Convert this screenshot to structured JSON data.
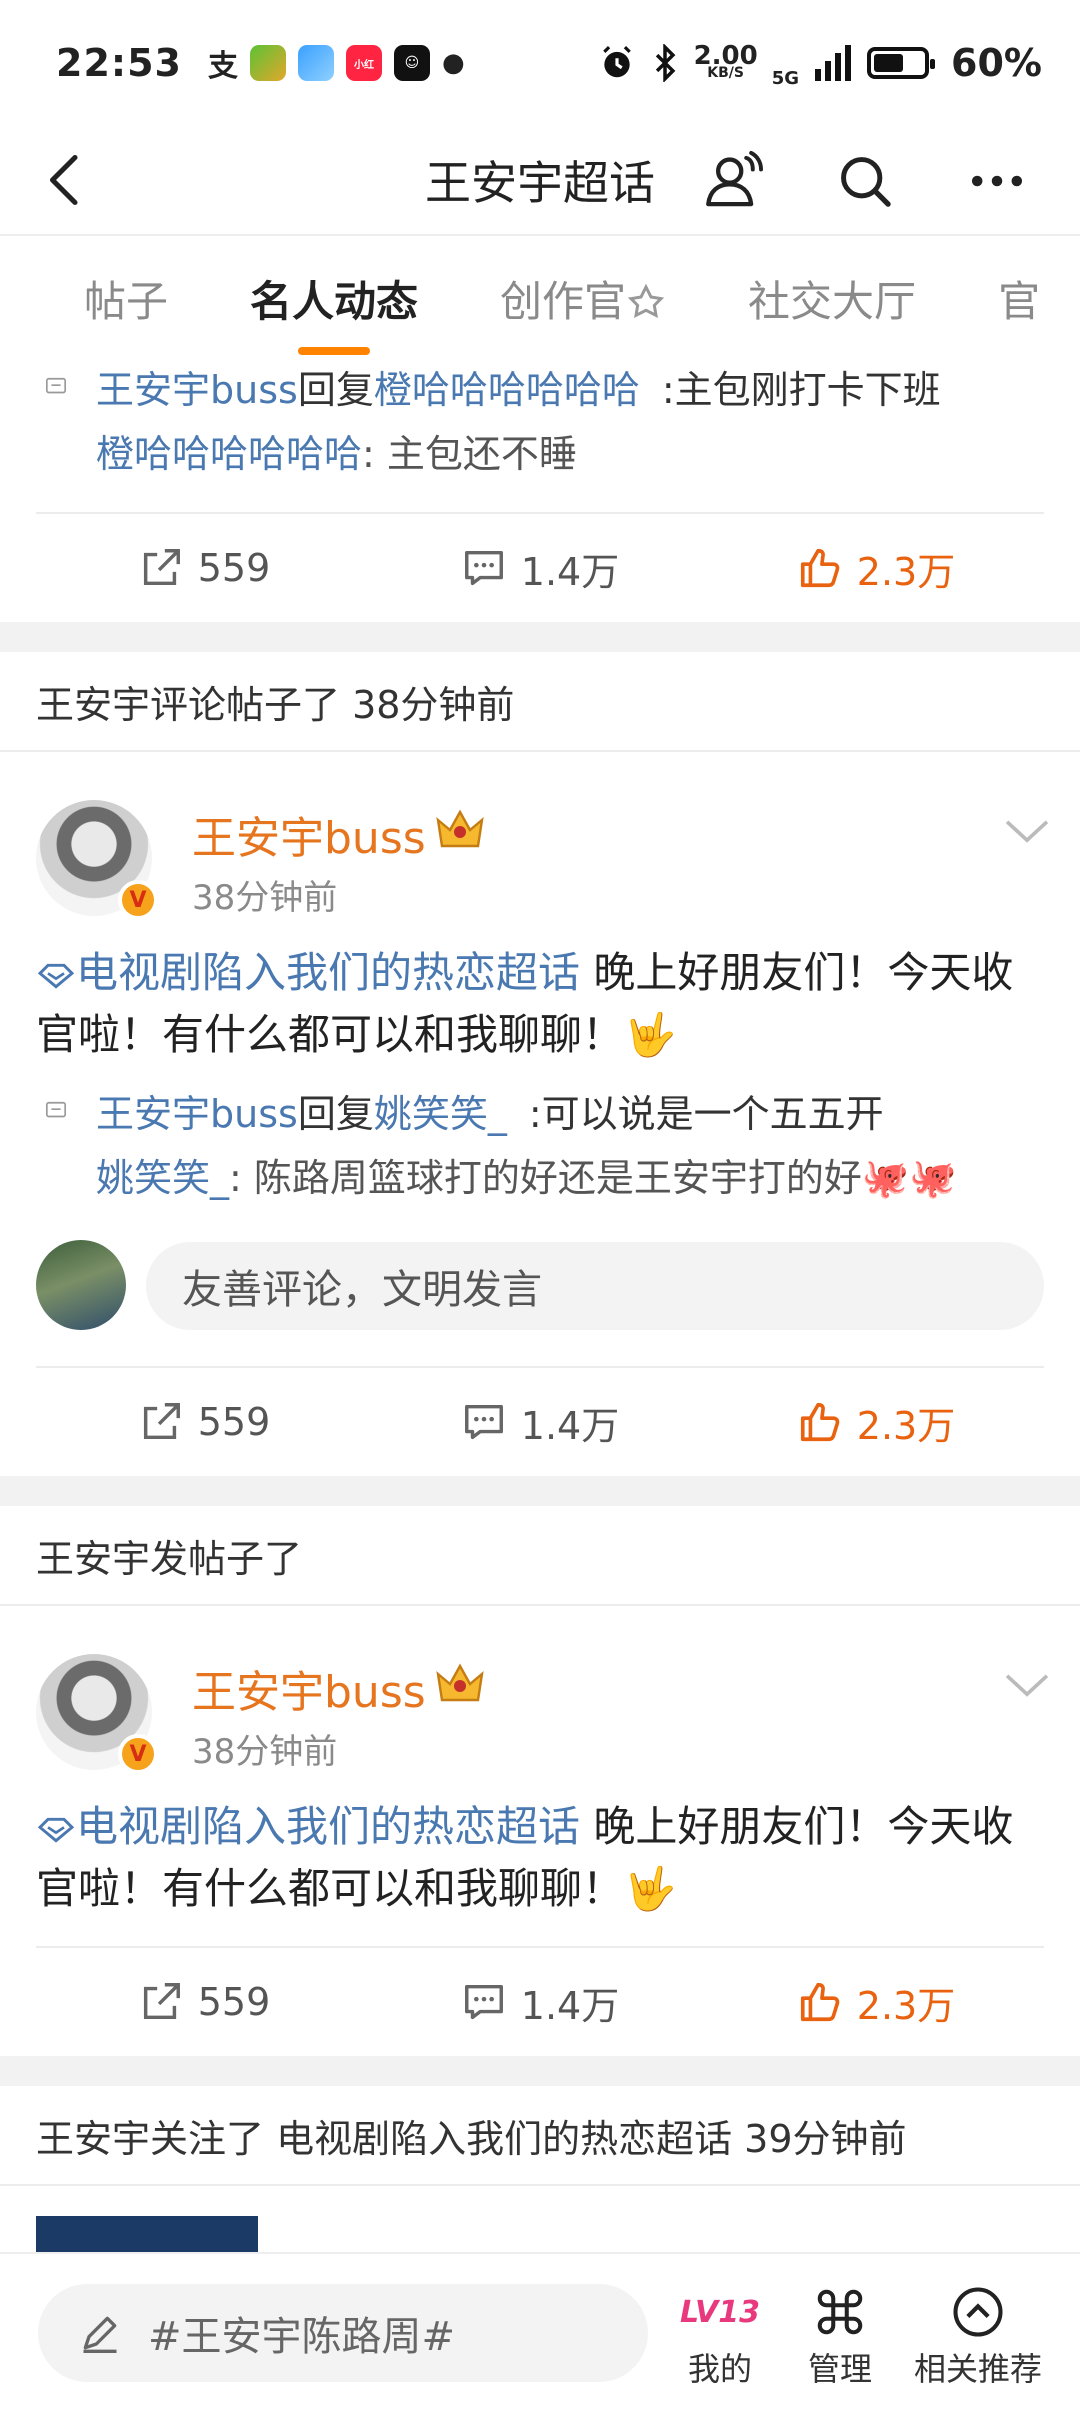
{
  "status_bar": {
    "time": "22:53",
    "net_speed_value": "2.00",
    "net_speed_unit": "KB/S",
    "network": "5G",
    "battery": "60%",
    "battery_level": 0.6
  },
  "nav": {
    "title": "王安宇超话"
  },
  "tabs": [
    {
      "label": "帖子",
      "active": false
    },
    {
      "label": "名人动态",
      "active": true
    },
    {
      "label": "创作官",
      "active": false
    },
    {
      "label": "社交大厅",
      "active": false
    },
    {
      "label": "官",
      "active": false
    }
  ],
  "feed": {
    "top_reply": {
      "replier": "王安宇buss",
      "verb": "回复",
      "target": "橙哈哈哈哈哈哈",
      "text": ":主包刚打卡下班",
      "original_author": "橙哈哈哈哈哈哈",
      "original_text": ": 主包还不睡"
    },
    "top_actions": {
      "repost": "559",
      "comment": "1.4万",
      "like": "2.3万"
    },
    "section1": {
      "header": "王安宇评论帖子了 38分钟前",
      "post": {
        "username": "王安宇buss",
        "time": "38分钟前",
        "topic": "电视剧陷入我们的热恋超话",
        "text": " 晚上好朋友们！今天收官啦！有什么都可以和我聊聊！🤟",
        "reply": {
          "replier": "王安宇buss",
          "verb": "回复",
          "target": "姚笑笑_",
          "text": ":可以说是一个五五开",
          "original_author": "姚笑笑_",
          "original_text": ": 陈路周篮球打的好还是王安宇打的好🐙🐙"
        },
        "comment_placeholder": "友善评论，文明发言",
        "actions": {
          "repost": "559",
          "comment": "1.4万",
          "like": "2.3万"
        }
      }
    },
    "section2": {
      "header": "王安宇发帖子了",
      "post": {
        "username": "王安宇buss",
        "time": "38分钟前",
        "topic": "电视剧陷入我们的热恋超话",
        "text": " 晚上好朋友们！今天收官啦！有什么都可以和我聊聊！🤟",
        "actions": {
          "repost": "559",
          "comment": "1.4万",
          "like": "2.3万"
        }
      }
    },
    "section3": {
      "header": "王安宇关注了 电视剧陷入我们的热恋超话 39分钟前"
    }
  },
  "bottom_bar": {
    "search_placeholder": "#王安宇陈路周#",
    "level_badge": "LV13",
    "items": [
      {
        "label": "我的",
        "icon": "level-badge-icon"
      },
      {
        "label": "管理",
        "icon": "command-icon"
      },
      {
        "label": "相关推荐",
        "icon": "chevron-up-circle-icon"
      }
    ]
  },
  "colors": {
    "accent": "#ff8200",
    "username": "#e67520",
    "link": "#4a78b0",
    "like": "#e8620f"
  }
}
